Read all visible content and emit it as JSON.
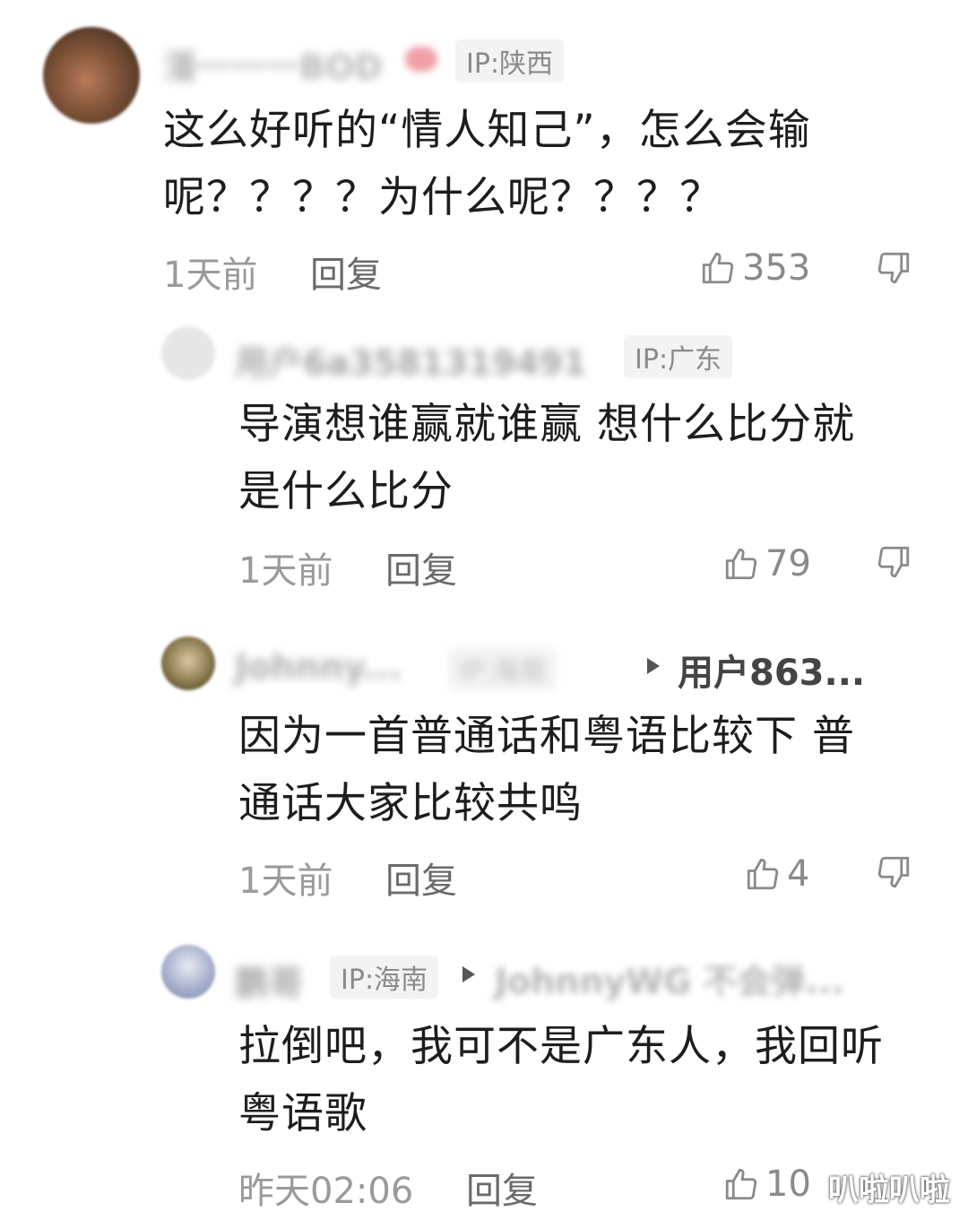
{
  "comments": [
    {
      "username": "潘一一一BOD",
      "ip": "IP:陕西",
      "text_line1": "这么好听的“情人知己”，怎么会输",
      "text_line2": "呢？？？？为什么呢？？？？",
      "time": "1天前",
      "reply": "回复",
      "likes": "353"
    },
    {
      "username": "用户6a3581319491",
      "ip": "IP:广东",
      "text_line1": "导演想谁赢就谁赢 想什么比分就",
      "text_line2": "是什么比分",
      "time": "1天前",
      "reply": "回复",
      "likes": "79"
    },
    {
      "username": "Johnny...",
      "ip": "IP:海南",
      "reply_to": "用户863...",
      "text_line1": "因为一首普通话和粤语比较下 普",
      "text_line2": "通话大家比较共鸣",
      "time": "1天前",
      "reply": "回复",
      "likes": "4"
    },
    {
      "username": "鹏哥",
      "ip": "IP:海南",
      "reply_to": "JohnnyWG 不会弹...",
      "text_line1": "拉倒吧，我可不是广东人，我回听",
      "text_line2": "粤语歌",
      "time": "昨天02:06",
      "reply": "回复",
      "likes": "10"
    }
  ],
  "watermark": "叭啦叭啦",
  "icons": {
    "like": "thumbs-up-icon",
    "dislike": "thumbs-down-icon",
    "reply_arrow": "triangle-right-icon"
  }
}
